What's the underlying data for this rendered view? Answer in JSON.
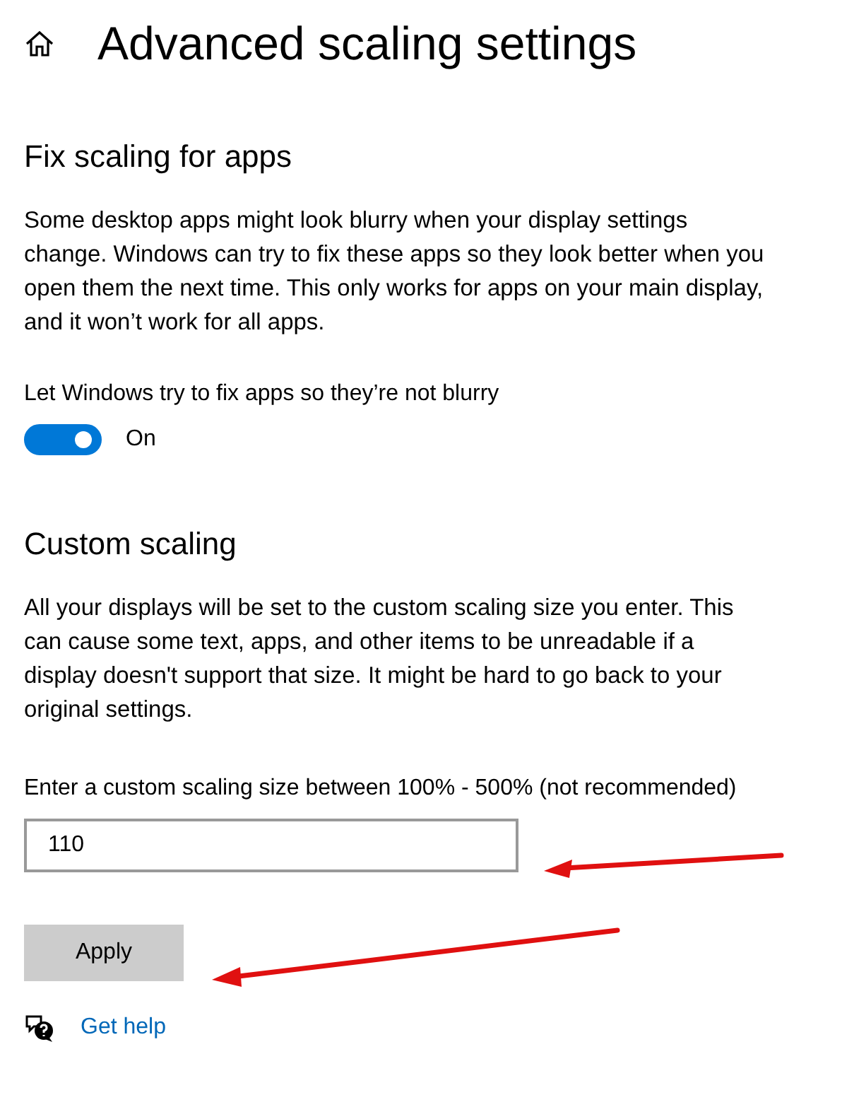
{
  "header": {
    "title": "Advanced scaling settings"
  },
  "fix_scaling": {
    "heading": "Fix scaling for apps",
    "description": "Some desktop apps might look blurry when your display settings change. Windows can try to fix these apps so they look better when you open them the next time. This only works for apps on your main display, and it won’t work for all apps.",
    "toggle": {
      "label": "Let Windows try to fix apps so they’re not blurry",
      "on": true,
      "state_text": "On"
    }
  },
  "custom_scaling": {
    "heading": "Custom scaling",
    "description": "All your displays will be set to the custom scaling size you enter. This can cause some text, apps, and other items to be unreadable if a display doesn't support that size. It might be hard to go back to your original settings.",
    "field": {
      "label": "Enter a custom scaling size between 100% - 500% (not recommended)",
      "value": "110"
    },
    "button": "Apply"
  },
  "help_link": "Get help"
}
